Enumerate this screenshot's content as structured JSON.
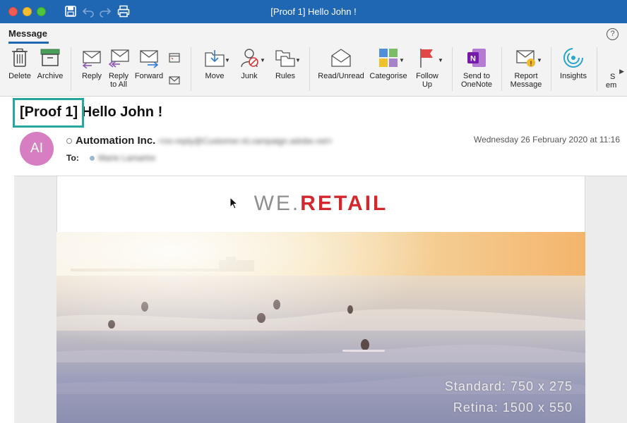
{
  "window": {
    "title": "[Proof 1]  Hello John !"
  },
  "ribbon": {
    "active_tab": "Message",
    "help": "?",
    "buttons": {
      "delete": "Delete",
      "archive": "Archive",
      "reply": "Reply",
      "reply_all_1": "Reply",
      "reply_all_2": "to All",
      "forward": "Forward",
      "move": "Move",
      "junk": "Junk",
      "rules": "Rules",
      "read_unread": "Read/Unread",
      "categorise": "Categorise",
      "follow_up_1": "Follow",
      "follow_up_2": "Up",
      "onenote_1": "Send to",
      "onenote_2": "OneNote",
      "report_1": "Report",
      "report_2": "Message",
      "insights": "Insights",
      "overflow_1": "S",
      "overflow_2": "em"
    }
  },
  "message": {
    "subject_tag": "[Proof 1]",
    "subject_rest": "Hello John !",
    "avatar_initials": "AI",
    "sender_name": "Automation Inc.",
    "sender_email": "<no-reply@Customer.rd.campaign.adobe.net>",
    "to_label": "To:",
    "to_name": "Marie Lamartre",
    "date": "Wednesday 26 February 2020 at 11:16"
  },
  "email_body": {
    "brand_part1": "WE.",
    "brand_part2": "RETAIL",
    "hero_line1": "Standard: 750 x 275",
    "hero_line2": "Retina: 1500 x 550"
  },
  "colors": {
    "titlebar": "#1f66b3",
    "highlight_box": "#2aa6a0",
    "avatar": "#d77dc2",
    "brand_red": "#d0282e"
  }
}
